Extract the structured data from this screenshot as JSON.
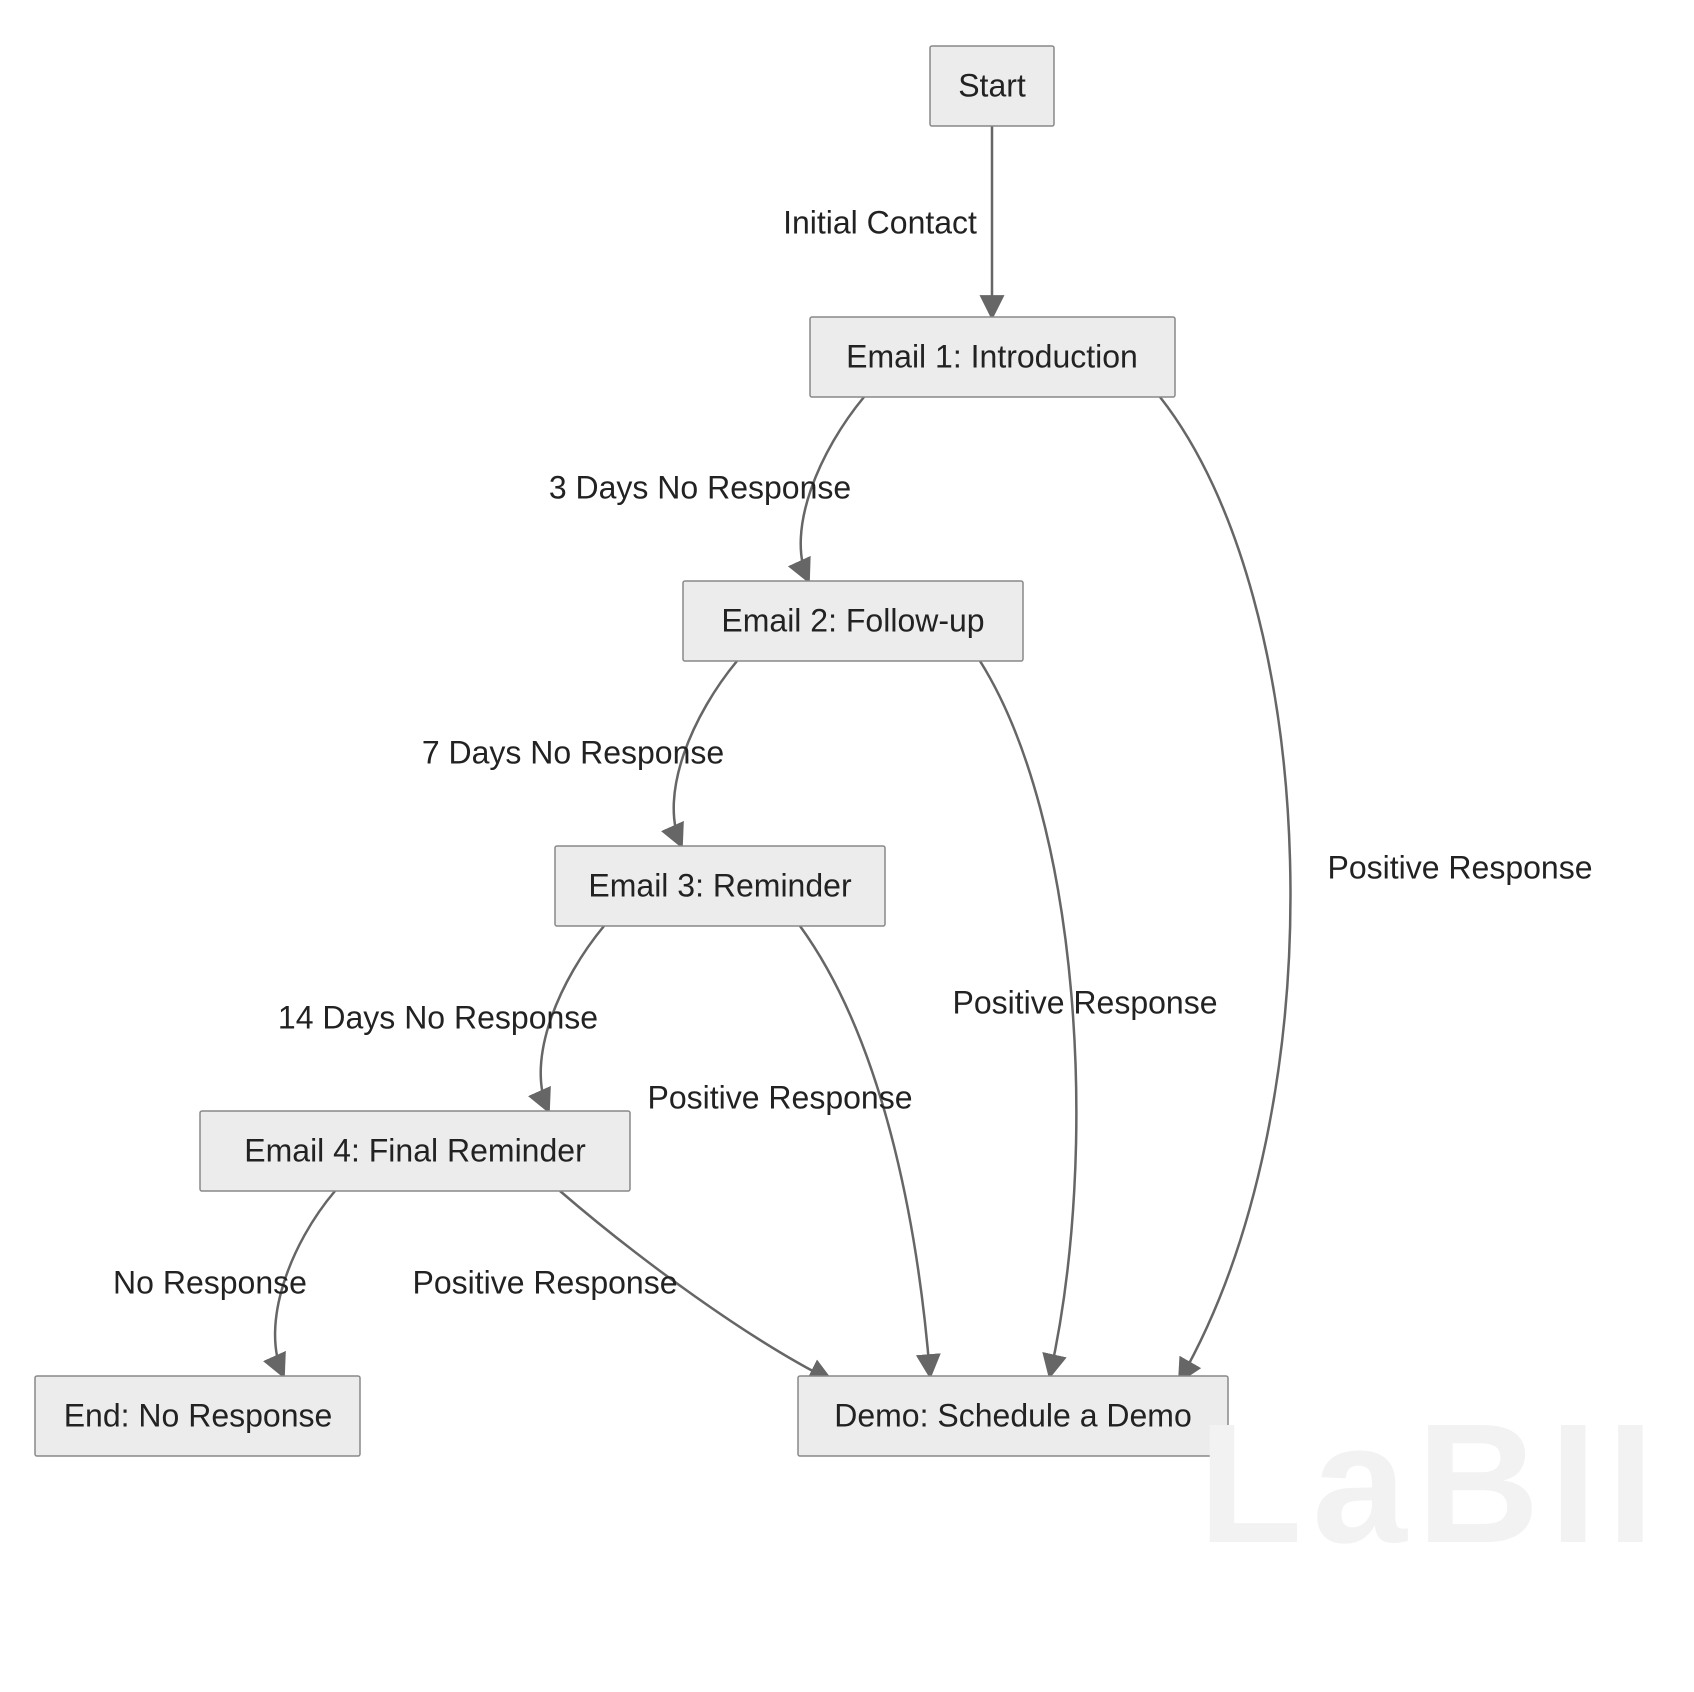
{
  "nodes": {
    "start": {
      "label": "Start"
    },
    "email1": {
      "label": "Email 1: Introduction"
    },
    "email2": {
      "label": "Email 2: Follow-up"
    },
    "email3": {
      "label": "Email 3: Reminder"
    },
    "email4": {
      "label": "Email 4: Final Reminder"
    },
    "end": {
      "label": "End: No Response"
    },
    "demo": {
      "label": "Demo: Schedule a Demo"
    }
  },
  "edges": {
    "start_email1": {
      "label": "Initial Contact"
    },
    "email1_email2": {
      "label": "3 Days No Response"
    },
    "email2_email3": {
      "label": "7 Days No Response"
    },
    "email3_email4": {
      "label": "14 Days No Response"
    },
    "email4_end": {
      "label": "No Response"
    },
    "email1_demo": {
      "label": "Positive Response"
    },
    "email2_demo": {
      "label": "Positive Response"
    },
    "email3_demo": {
      "label": "Positive Response"
    },
    "email4_demo": {
      "label": "Positive Response"
    }
  },
  "watermark": "LaBII"
}
